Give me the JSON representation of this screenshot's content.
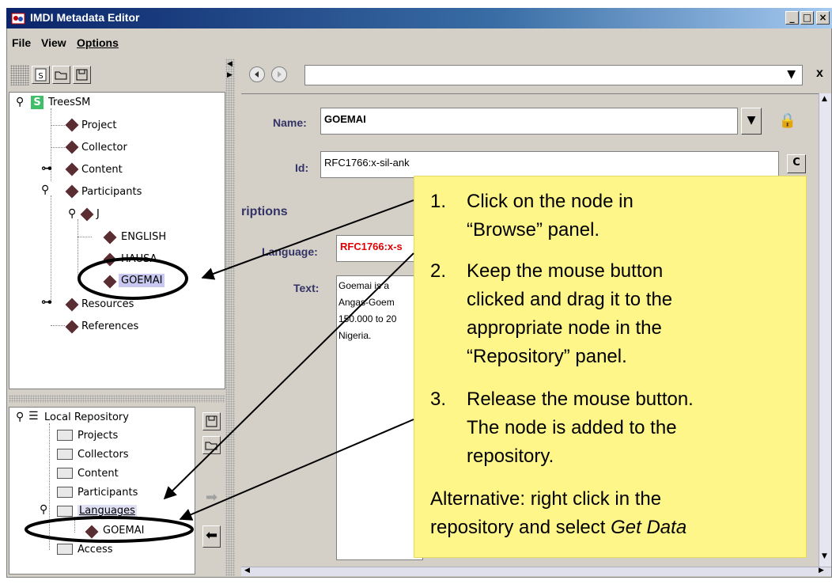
{
  "window": {
    "title": "IMDI Metadata Editor",
    "controls": {
      "minimize": "_",
      "maximize": "□",
      "close": "×"
    }
  },
  "menu": {
    "file": "File",
    "view": "View",
    "options": "Options"
  },
  "browse_tree": {
    "root": "TreesSM",
    "root_badge": "S",
    "items": {
      "project": "Project",
      "collector": "Collector",
      "content": "Content",
      "participants": "Participants",
      "participant_j": "J",
      "english": "ENGLISH",
      "hausa": "HAUSA",
      "goemai": "GOEMAI",
      "resources": "Resources",
      "references": "References"
    }
  },
  "repository_tree": {
    "root": "Local Repository",
    "items": {
      "projects": "Projects",
      "collectors": "Collectors",
      "content": "Content",
      "participants": "Participants",
      "languages": "Languages",
      "goemai": "GOEMAI",
      "access": "Access"
    }
  },
  "editor": {
    "close_label": "x",
    "name_label": "Name:",
    "name_value": "GOEMAI",
    "id_label": "Id:",
    "id_value": "RFC1766:x-sil-ank",
    "section_title": "riptions",
    "language_label": "Language:",
    "language_value": "RFC1766:x-s",
    "text_label": "Text:",
    "text_lines": [
      "Goemai is a",
      "Angas-Goem",
      "150.000 to 20",
      "Nigeria."
    ]
  },
  "callout": {
    "step1_num": "1.",
    "step1_line1": "Click on the node in",
    "step1_line2": "“Browse” panel.",
    "step2_num": "2.",
    "step2_line1": "Keep the mouse button",
    "step2_line2": "clicked and drag it to the",
    "step2_line3": "appropriate node in the",
    "step2_line4": "“Repository” panel.",
    "step3_num": "3.",
    "step3_line1": "Release the mouse button.",
    "step3_line2": "The node is added to the",
    "step3_line3": "repository.",
    "alt_line1": "Alternative: right click in the",
    "alt_line2_prefix": "repository and select ",
    "alt_line2_emph": "Get Data"
  },
  "colors": {
    "title_bar": "#0a246a",
    "diamond": "#5a2d32",
    "callout_bg": "#fff68a",
    "language_value": "#e00000",
    "label": "#333366"
  },
  "icons": {
    "app": "app-icon",
    "pin": "pin-icon",
    "node": "diamond-icon",
    "folder": "folder-icon",
    "save": "floppy-icon",
    "open": "folder-open-icon",
    "back": "back-icon",
    "forward": "forward-icon",
    "lock": "lock-icon",
    "copy": "copy-icon"
  }
}
